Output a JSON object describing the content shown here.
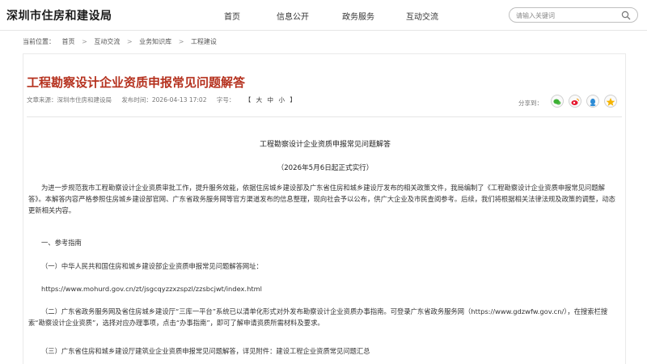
{
  "header": {
    "logo": "深圳市住房和建设局",
    "nav": [
      "首页",
      "信息公开",
      "政务服务",
      "互动交流"
    ],
    "search_placeholder": "请输入关键词"
  },
  "breadcrumb": {
    "label": "当前位置：",
    "items": [
      "首页",
      "互动交流",
      "业务知识库",
      "工程建设"
    ],
    "separator": ">"
  },
  "article": {
    "title": "工程勘察设计企业资质申报常见问题解答",
    "source": "文章来源：深圳市住房和建设局",
    "published": "发布时间：2026-04-13 17:02",
    "font_label": "字号：",
    "font_sizes": [
      "【",
      "大",
      "中",
      "小",
      "】"
    ],
    "share_label": "分享到：",
    "share_icons": [
      "wechat-icon",
      "weibo-icon",
      "qq-icon",
      "qzone-icon"
    ],
    "doc_title": "工程勘察设计企业资质申报常见问题解答",
    "doc_subtitle": "（2026年5月6日起正式实行）",
    "paragraphs": [
      "为进一步规范我市工程勘察设计企业资质审批工作，提升服务效能，依据住房城乡建设部及广东省住房和城乡建设厅发布的相关政策文件，我局编制了《工程勘察设计企业资质申报常见问题解答》。本解答内容严格参照住房城乡建设部官网、广东省政务服务网等官方渠道发布的信息整理，现向社会予以公布，供广大企业及市民查阅参考。后续，我们将根据相关法律法规及政策的调整，动态更新相关内容。",
      "一、参考指南",
      "（一）中华人民共和国住房和城乡建设部企业资质申报常见问题解答网址：",
      "https://www.mohurd.gov.cn/zt/jsgcqyzzxzspzl/zzsbcjwt/index.html",
      "（二）广东省政务服务网及省住房城乡建设厅“三库一平台”系统已以清单化形式对外发布勘察设计企业资质办事指南。可登录广东省政务服务网（https://www.gdzwfw.gov.cn/），在搜索栏搜索“勘察设计企业资质”，选择对应办理事项，点击“办事指南”，即可了解申请资质所需材料及要求。",
      "（三）广东省住房和城乡建设厅建筑业企业资质申报常见问题解答，详见附件：建设工程企业资质常见问题汇总"
    ]
  },
  "colors": {
    "title_red": "#b5311e",
    "wechat": "#3cb034",
    "weibo": "#e6162d",
    "qq": "#2b8bd6",
    "qzone": "#f5b400"
  }
}
